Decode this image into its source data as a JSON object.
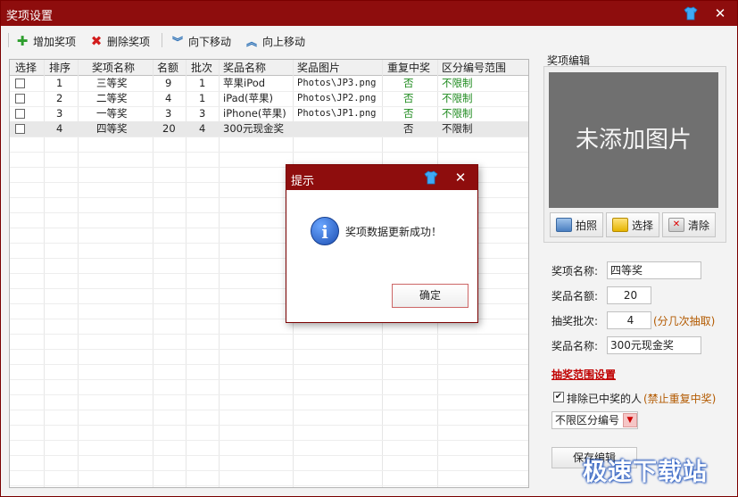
{
  "window": {
    "title": "奖项设置"
  },
  "toolbar": {
    "add": "增加奖项",
    "delete": "删除奖项",
    "move_down": "向下移动",
    "move_up": "向上移动"
  },
  "table": {
    "headers": [
      "选择",
      "排序",
      "奖项名称",
      "名额",
      "批次",
      "奖品名称",
      "奖品图片",
      "重复中奖",
      "区分编号范围"
    ],
    "rows": [
      {
        "order": "1",
        "prize_level": "三等奖",
        "quota": "9",
        "batch": "1",
        "prize": "苹果iPod",
        "image": "Photos\\JP3.png",
        "repeat": "否",
        "range": "不限制"
      },
      {
        "order": "2",
        "prize_level": "二等奖",
        "quota": "4",
        "batch": "1",
        "prize": "iPad(苹果)",
        "image": "Photos\\JP2.png",
        "repeat": "否",
        "range": "不限制"
      },
      {
        "order": "3",
        "prize_level": "一等奖",
        "quota": "3",
        "batch": "3",
        "prize": "iPhone(苹果)",
        "image": "Photos\\JP1.png",
        "repeat": "否",
        "range": "不限制"
      },
      {
        "order": "4",
        "prize_level": "四等奖",
        "quota": "20",
        "batch": "4",
        "prize": "300元现金奖",
        "image": "",
        "repeat": "否",
        "range": "不限制"
      }
    ]
  },
  "editor": {
    "group_title": "奖项编辑",
    "image_placeholder": "未添加图片",
    "photo_btn": "拍照",
    "select_btn": "选择",
    "clear_btn": "清除",
    "name_label": "奖项名称:",
    "name_value": "四等奖",
    "quota_label": "奖品名额:",
    "quota_value": "20",
    "batch_label": "抽奖批次:",
    "batch_value": "4",
    "batch_hint": "(分几次抽取)",
    "prize_label": "奖品名称:",
    "prize_value": "300元现金奖",
    "range_title": "抽奖范围设置",
    "exclude_label": "排除已中奖的人",
    "exclude_hint": "(禁止重复中奖)",
    "range_select": "不限区分编号",
    "save_btn": "保存编辑"
  },
  "dialog": {
    "title": "提示",
    "message": "奖项数据更新成功！",
    "ok": "确定"
  },
  "watermark": "极速下载站",
  "colors": {
    "titlebar": "#8e0d0d",
    "green_text": "#1d8a1d",
    "red_text": "#c00000"
  }
}
